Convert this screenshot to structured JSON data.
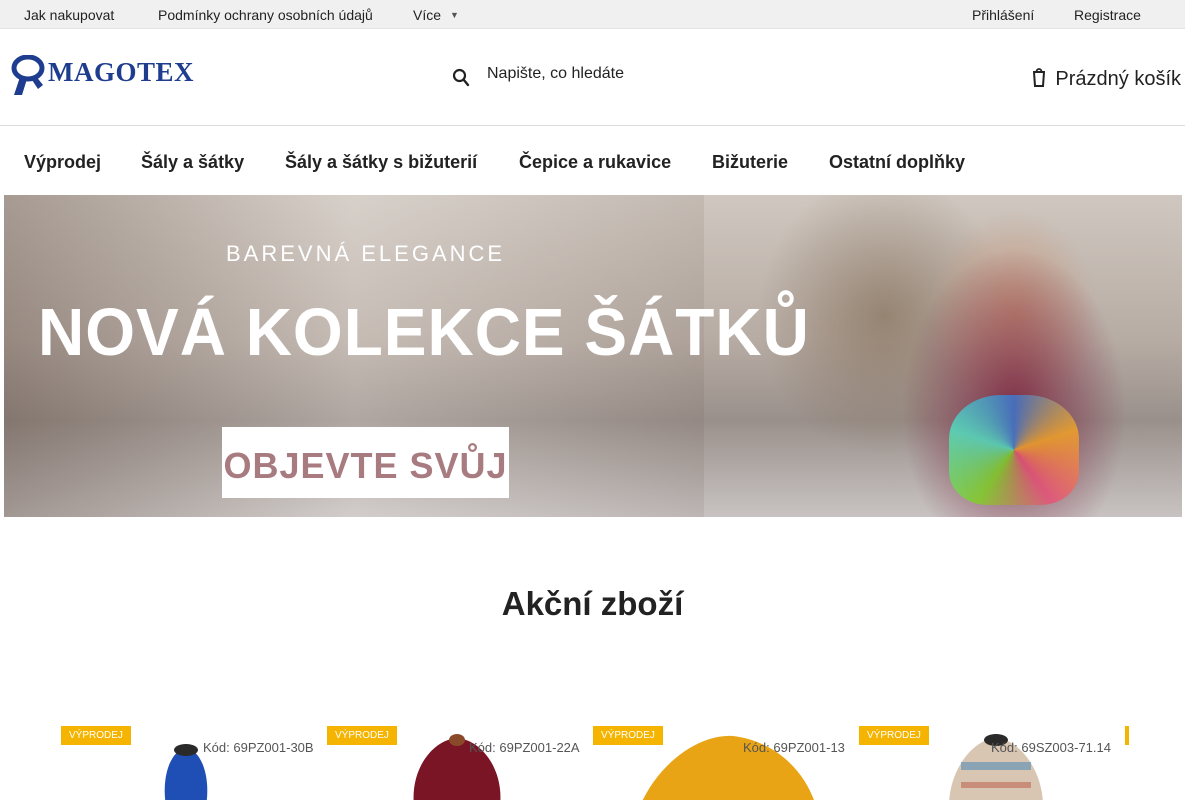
{
  "topbar": {
    "links": [
      "Jak nakupovat",
      "Podmínky ochrany osobních údajů",
      "Více"
    ],
    "more_icon": "chevron-down-icon",
    "login": "Přihlášení",
    "register": "Registrace"
  },
  "header": {
    "logo_text": "MAGOTEX",
    "search_placeholder": "Napište, co hledáte",
    "search_icon": "search-icon",
    "cart_icon": "cart-icon",
    "cart_label": "Prázdný košík"
  },
  "nav": {
    "items": [
      "Výprodej",
      "Šály a šátky",
      "Šály a šátky s bižuterií",
      "Čepice a rukavice",
      "Bižuterie",
      "Ostatní doplňky"
    ]
  },
  "banner": {
    "tagline": "BAREVNÁ ELEGANCE",
    "headline": "NOVÁ KOLEKCE ŠÁTKŮ",
    "cta": "OBJEVTE SVŮJ"
  },
  "section": {
    "title": "Akční zboží"
  },
  "products": [
    {
      "badge": "VÝPRODEJ",
      "code": "Kód: 69PZ001-30B",
      "color": "#1f4fb5"
    },
    {
      "badge": "VÝPRODEJ",
      "code": "Kód: 69PZ001-22A",
      "color": "#7a1525"
    },
    {
      "badge": "VÝPRODEJ",
      "code": "Kód: 69PZ001-13",
      "color": "#e9a415"
    },
    {
      "badge": "VÝPRODEJ",
      "code": "Kód: 69SZ003-71.14",
      "color": "#c9b7a6"
    }
  ],
  "colors": {
    "brand": "#1e3d8f",
    "badge": "#f5b400",
    "topbar_bg": "#f0f0f0"
  }
}
